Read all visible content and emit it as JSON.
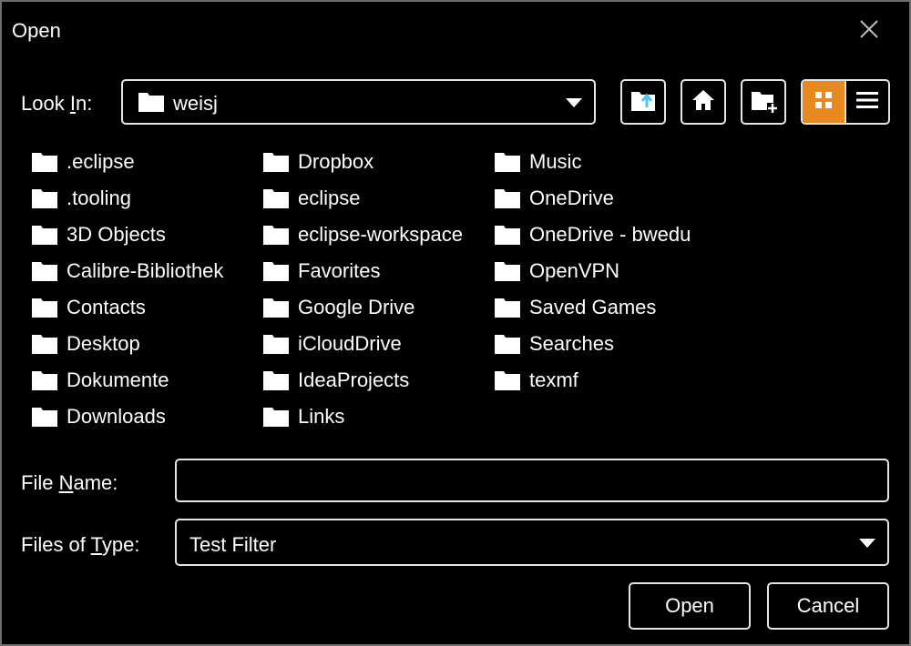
{
  "window": {
    "title": "Open",
    "close_icon": "close-icon"
  },
  "look_in": {
    "label_prefix": "Look ",
    "label_mnemonic": "I",
    "label_suffix": "n:",
    "value": "weisj",
    "folder_icon": "folder-icon"
  },
  "toolbar": {
    "up_folder_icon": "up-folder-icon",
    "home_icon": "home-icon",
    "new_folder_icon": "new-folder-icon",
    "list_view_icon": "grid-view-icon",
    "details_view_icon": "details-view-icon",
    "active_view": "list",
    "accent": "#e8891f",
    "accent_icon_color": "#4fc3f7"
  },
  "files": [
    ".eclipse",
    ".tooling",
    "3D Objects",
    "Calibre-Bibliothek",
    "Contacts",
    "Desktop",
    "Dokumente",
    "Downloads",
    "Dropbox",
    "eclipse",
    "eclipse-workspace",
    "Favorites",
    "Google Drive",
    "iCloudDrive",
    "IdeaProjects",
    "Links",
    "Music",
    "OneDrive",
    "OneDrive - bwedu",
    "OpenVPN",
    "Saved Games",
    "Searches",
    "texmf"
  ],
  "file_name": {
    "label_prefix": "File ",
    "label_mnemonic": "N",
    "label_suffix": "ame:",
    "value": ""
  },
  "file_type": {
    "label_prefix": "Files of ",
    "label_mnemonic": "T",
    "label_suffix": "ype:",
    "value": "Test Filter"
  },
  "buttons": {
    "open": "Open",
    "cancel": "Cancel"
  }
}
